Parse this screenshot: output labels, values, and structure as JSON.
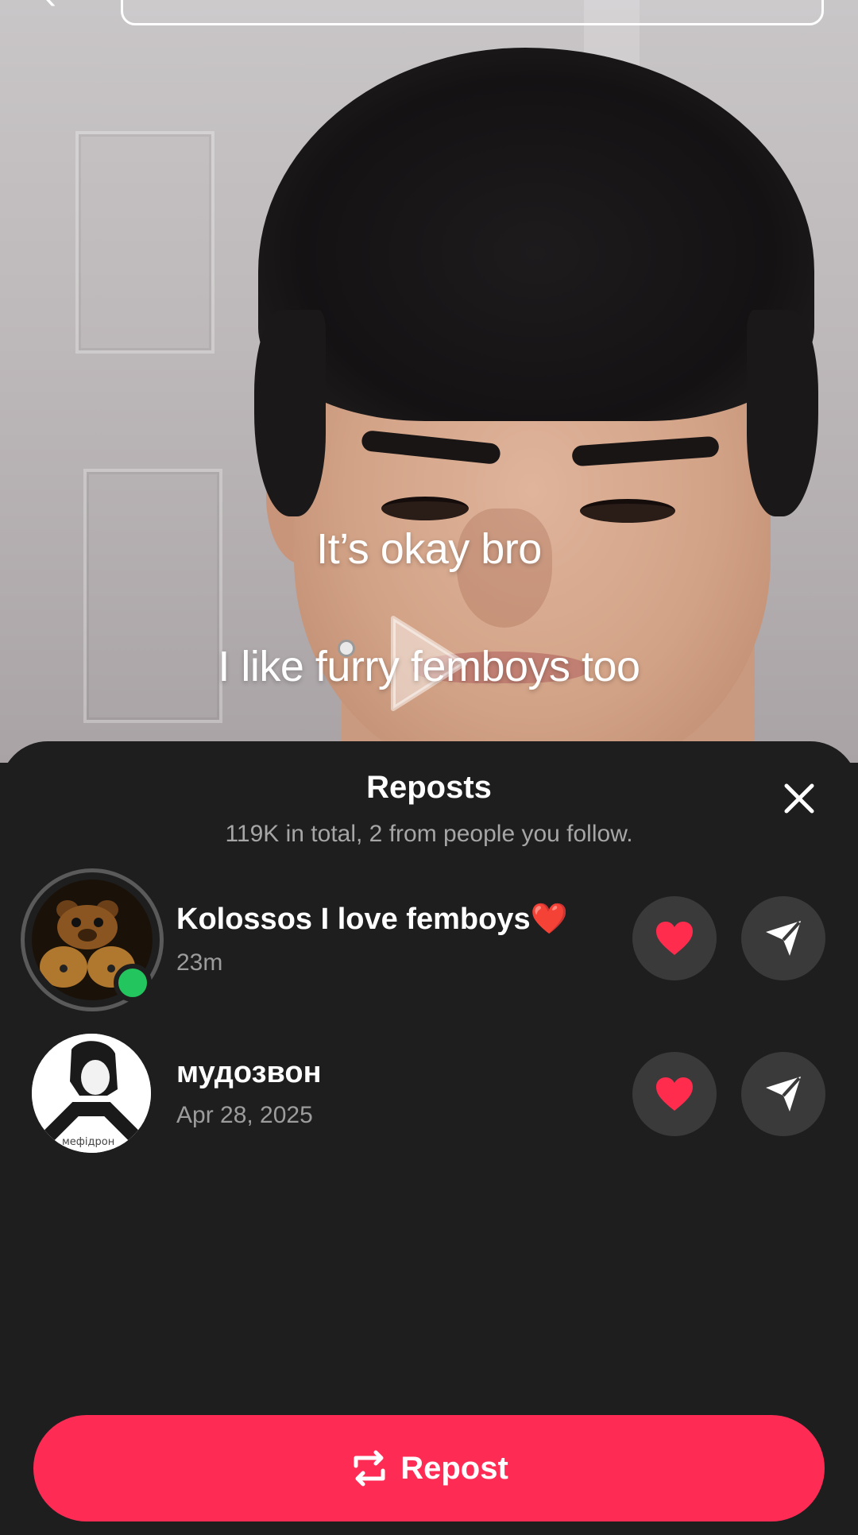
{
  "video": {
    "caption_line1": "It’s okay bro",
    "caption_line2": "I like furry femboys too"
  },
  "sheet": {
    "title": "Reposts",
    "subtitle": "119K in total, 2 from people you follow.",
    "close_icon": "close-icon"
  },
  "reposts": [
    {
      "name": "Kolossos I love femboys",
      "name_emoji": "❤️",
      "time": "23m",
      "online": true,
      "avatar_text": ""
    },
    {
      "name": "мудозвон",
      "time": "Apr 28, 2025",
      "online": false,
      "avatar_text": "мефідрон"
    }
  ],
  "actions": {
    "like_icon": "heart-icon",
    "send_icon": "send-icon"
  },
  "repost_button": {
    "label": "Repost",
    "icon": "repost-icon"
  },
  "colors": {
    "accent": "#fe2c55",
    "sheet_bg": "#1e1e1e",
    "button_bg": "#3a3a3a",
    "heart": "#ff2c4d",
    "online": "#22c55e"
  }
}
